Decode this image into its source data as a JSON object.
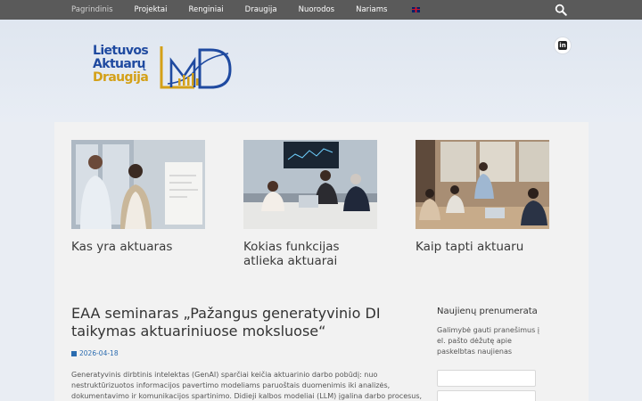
{
  "nav": {
    "items": [
      "Pagrindinis",
      "Projektai",
      "Renginiai",
      "Draugija",
      "Nuorodos",
      "Nariams"
    ],
    "active_index": 0,
    "language_icon": "uk-flag-icon",
    "search_icon": "search-icon"
  },
  "header": {
    "logo_line1": "Lietuvos",
    "logo_line2": "Aktuarų",
    "logo_line3": "Draugija",
    "social_icon": "linkedin-icon",
    "social_glyph": "in"
  },
  "cards": [
    {
      "title": "Kas yra aktuaras"
    },
    {
      "title": "Kokias funkcijas atlieka aktuarai"
    },
    {
      "title": "Kaip tapti aktuaru"
    }
  ],
  "article": {
    "title": "EAA seminaras „Pažangus generatyvinio DI taikymas aktuariniuose moksluose“",
    "date": "2026-04-18",
    "excerpt": "Generatyvinis dirbtinis intelektas (GenAI) sparčiai keičia aktuarinio darbo pobūdį: nuo nestruktūrizuotos informacijos pavertimo modeliams paruoštais duomenimis iki analizės, dokumentavimo ir komunikacijos spartinimo. Didieji kalbos modeliai (LLM) įgalina darbo procesus, kurie"
  },
  "sidebar": {
    "title": "Naujienų prenumerata",
    "text": "Galimybė gauti pranešimus į el. pašto dėžutę apie paskelbtas naujienas"
  },
  "colors": {
    "nav_bg": "#5a5a5a",
    "logo_blue": "#1f4aa0",
    "logo_gold": "#d4a017",
    "link_blue": "#2b6cb0"
  }
}
